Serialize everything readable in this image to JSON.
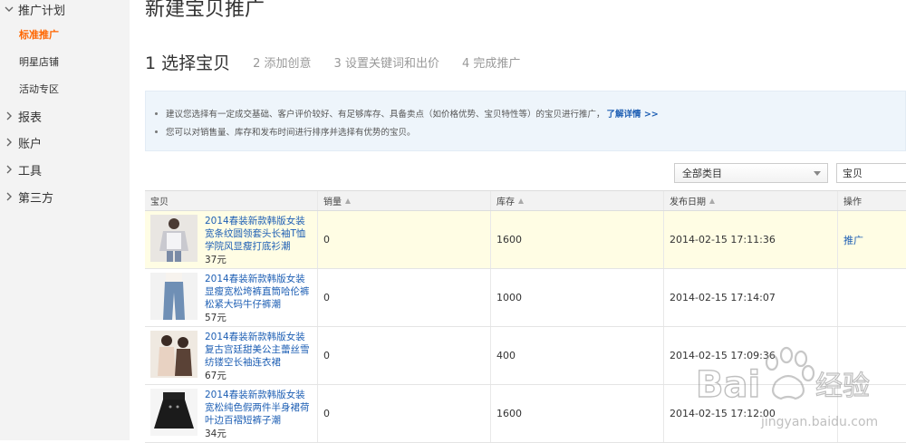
{
  "sidebar": {
    "groups": [
      {
        "label": "推广计划",
        "expanded": true,
        "items": [
          {
            "label": "标准推广",
            "active": true
          },
          {
            "label": "明星店铺",
            "active": false
          },
          {
            "label": "活动专区",
            "active": false
          }
        ]
      },
      {
        "label": "报表",
        "expanded": false
      },
      {
        "label": "账户",
        "expanded": false
      },
      {
        "label": "工具",
        "expanded": false
      },
      {
        "label": "第三方",
        "expanded": false
      }
    ]
  },
  "page": {
    "title": "新建宝贝推广"
  },
  "steps": [
    {
      "label": "1 选择宝贝",
      "current": true
    },
    {
      "label": "2 添加创意",
      "current": false
    },
    {
      "label": "3 设置关键词和出价",
      "current": false
    },
    {
      "label": "4 完成推广",
      "current": false
    }
  ],
  "tips": {
    "tip1": "建议您选择有一定成交基础、客户评价较好、有足够库存、具备卖点（如价格优势、宝贝特性等）的宝贝进行推广，",
    "tip1_link": "了解详情 >>",
    "tip2": "您可以对销售量、库存和发布时间进行排序并选择有优势的宝贝。"
  },
  "filters": {
    "category_selected": "全部类目",
    "search_value": "宝贝"
  },
  "table": {
    "headers": {
      "item": "宝贝",
      "sales": "销量",
      "stock": "库存",
      "date": "发布日期",
      "action": "操作"
    },
    "rows": [
      {
        "name": "2014春装新款韩版女装宽条纹圆领套头长袖T恤学院风显瘦打底衫潮",
        "price": "37元",
        "sales": "0",
        "stock": "1600",
        "date": "2014-02-15 17:11:36",
        "action": "推广"
      },
      {
        "name": "2014春装新款韩版女装显瘦宽松垮裤直筒哈伦裤松紧大码牛仔裤潮",
        "price": "57元",
        "sales": "0",
        "stock": "1000",
        "date": "2014-02-15 17:14:07",
        "action": ""
      },
      {
        "name": "2014春装新款韩版女装复古宫廷甜美公主蕾丝雪纺镂空长袖连衣裙",
        "price": "67元",
        "sales": "0",
        "stock": "400",
        "date": "2014-02-15 17:09:36",
        "action": ""
      },
      {
        "name": "2014春装新款韩版女装宽松纯色假两件半身裙荷叶边百褶短裤子潮",
        "price": "34元",
        "sales": "0",
        "stock": "1600",
        "date": "2014-02-15 17:12:00",
        "action": ""
      }
    ]
  },
  "watermark": {
    "text": "Bai 经验",
    "url": "jingyan.baidu.com"
  },
  "colors": {
    "accent": "#ff6600",
    "link": "#1e5fb4",
    "highlight_row": "#fffde4",
    "tips_bg": "#eef5fb"
  }
}
